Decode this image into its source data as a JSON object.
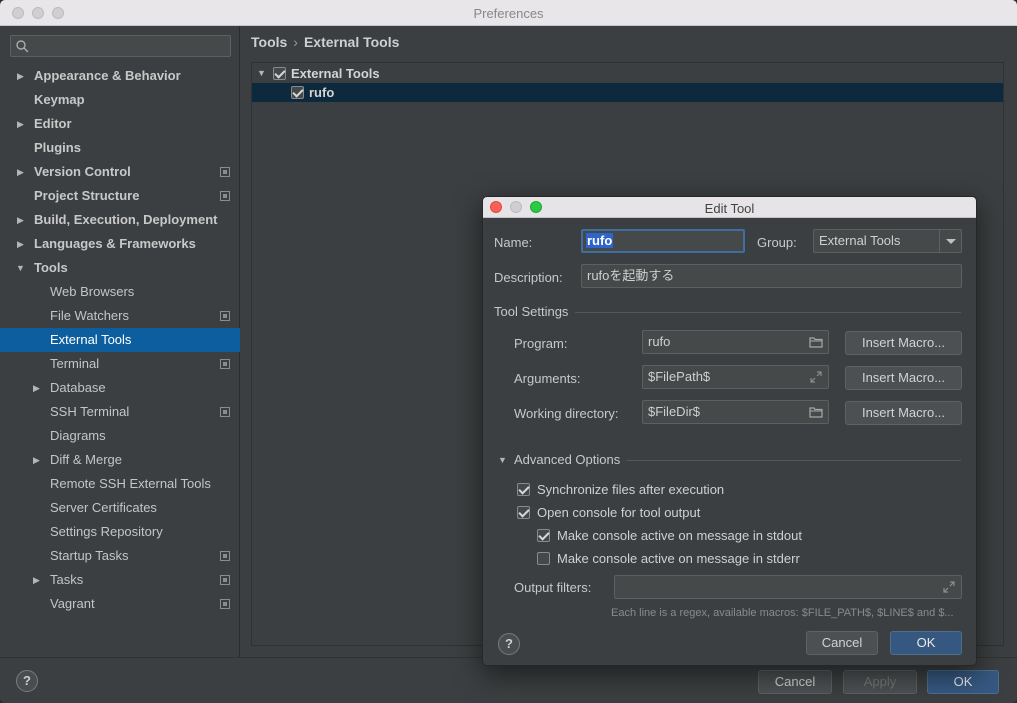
{
  "window": {
    "title": "Preferences"
  },
  "search": {
    "placeholder": ""
  },
  "sidebar": {
    "items": [
      {
        "label": "Appearance & Behavior",
        "expandable": true,
        "badge": false
      },
      {
        "label": "Keymap",
        "expandable": false,
        "badge": false
      },
      {
        "label": "Editor",
        "expandable": true,
        "badge": false
      },
      {
        "label": "Plugins",
        "expandable": false,
        "badge": false
      },
      {
        "label": "Version Control",
        "expandable": true,
        "badge": true
      },
      {
        "label": "Project Structure",
        "expandable": false,
        "badge": true
      },
      {
        "label": "Build, Execution, Deployment",
        "expandable": true,
        "badge": false
      },
      {
        "label": "Languages & Frameworks",
        "expandable": true,
        "badge": false
      },
      {
        "label": "Tools",
        "expandable": true,
        "expanded": true,
        "badge": false
      },
      {
        "label": "Web Browsers",
        "badge": false
      },
      {
        "label": "File Watchers",
        "badge": true
      },
      {
        "label": "External Tools",
        "badge": false,
        "selected": true
      },
      {
        "label": "Terminal",
        "badge": true
      },
      {
        "label": "Database",
        "expandable": true,
        "badge": false
      },
      {
        "label": "SSH Terminal",
        "badge": true
      },
      {
        "label": "Diagrams",
        "badge": false
      },
      {
        "label": "Diff & Merge",
        "expandable": true,
        "badge": false
      },
      {
        "label": "Remote SSH External Tools",
        "badge": false
      },
      {
        "label": "Server Certificates",
        "badge": false
      },
      {
        "label": "Settings Repository",
        "badge": false
      },
      {
        "label": "Startup Tasks",
        "badge": true
      },
      {
        "label": "Tasks",
        "expandable": true,
        "badge": true
      },
      {
        "label": "Vagrant",
        "badge": true
      }
    ]
  },
  "breadcrumb": {
    "parent": "Tools",
    "separator": "›",
    "current": "External Tools"
  },
  "tools_tree": {
    "group": {
      "label": "External Tools",
      "checked": true
    },
    "item": {
      "label": "rufo",
      "checked": true
    }
  },
  "toolbar": {
    "add": "+",
    "remove": "−",
    "edit": "✎",
    "up": "▲",
    "down": "▼",
    "copy": "⧉"
  },
  "footer": {
    "help": "?",
    "cancel": "Cancel",
    "apply": "Apply",
    "ok": "OK"
  },
  "dialog": {
    "title": "Edit Tool",
    "name_label": "Name:",
    "name_value": "rufo",
    "group_label": "Group:",
    "group_value": "External Tools",
    "description_label": "Description:",
    "description_value": "rufoを起動する",
    "tool_settings_title": "Tool Settings",
    "program_label": "Program:",
    "program_value": "rufo",
    "arguments_label": "Arguments:",
    "arguments_value": "$FilePath$",
    "workdir_label": "Working directory:",
    "workdir_value": "$FileDir$",
    "insert_macro": "Insert Macro...",
    "advanced_title": "Advanced Options",
    "sync_files": "Synchronize files after execution",
    "open_console": "Open console for tool output",
    "active_stdout": "Make console active on message in stdout",
    "active_stderr": "Make console active on message in stderr",
    "output_filters_label": "Output filters:",
    "output_filters_value": "",
    "hint": "Each line is a regex, available macros: $FILE_PATH$, $LINE$ and $...",
    "help": "?",
    "cancel": "Cancel",
    "ok": "OK"
  },
  "colors": {
    "accent": "#0d5e9e",
    "background": "#3c3f41",
    "primary_button": "#365880"
  }
}
